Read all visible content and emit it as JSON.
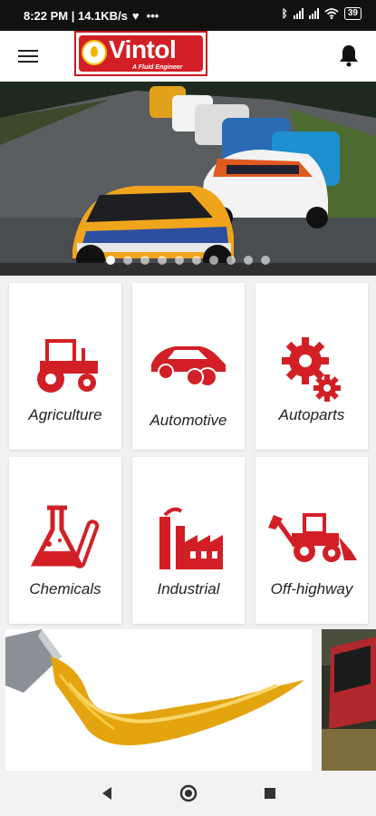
{
  "status": {
    "time_speed": "8:22 PM | 14.1KB/s",
    "battery": "39"
  },
  "header": {
    "brand": "Vintol",
    "tagline": "A Fluid Engineer"
  },
  "banner": {
    "slides": 10,
    "active_slide": 1
  },
  "categories": [
    {
      "label": "Agriculture"
    },
    {
      "label": "Automotive"
    },
    {
      "label": "Autoparts"
    },
    {
      "label": "Chemicals"
    },
    {
      "label": "Industrial"
    },
    {
      "label": "Off-highway"
    }
  ],
  "colors": {
    "brand_red": "#d21f26",
    "accent_yellow": "#f2b600"
  }
}
